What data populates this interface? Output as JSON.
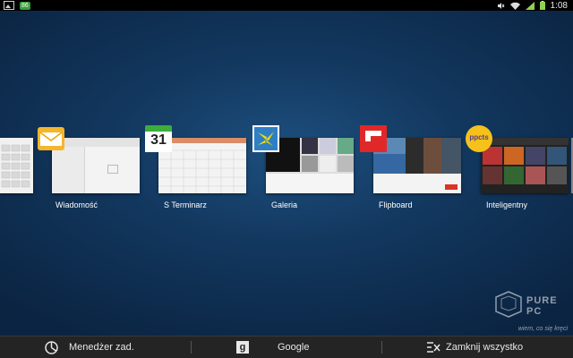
{
  "status_bar": {
    "left_icons": [
      "image-icon",
      "notification-badge"
    ],
    "badge_text": "86",
    "right_icons": [
      "mute-icon",
      "wifi-icon",
      "signal-icon",
      "battery-icon"
    ],
    "time": "1:08"
  },
  "recent_apps": [
    {
      "label": "Wiadomość",
      "icon": "messages-icon"
    },
    {
      "label": "S Terminarz",
      "icon": "calendar-icon",
      "icon_text": "31"
    },
    {
      "label": "Galeria",
      "icon": "gallery-icon"
    },
    {
      "label": "Flipboard",
      "icon": "flipboard-icon"
    },
    {
      "label": "Inteligentny",
      "icon": "smart-icon",
      "icon_text": "ppcts"
    }
  ],
  "bottom_bar": {
    "task_manager_label": "Menedżer zad.",
    "google_label": "Google",
    "google_icon_text": "g",
    "close_all_label": "Zamknij wszystko"
  },
  "watermark": {
    "brand": "PURE PC",
    "tagline": "wiem, co się kręci"
  },
  "colors": {
    "background": "#12375e",
    "status_bar": "#000000",
    "bottom_bar": "#242424",
    "text": "#ffffff"
  }
}
